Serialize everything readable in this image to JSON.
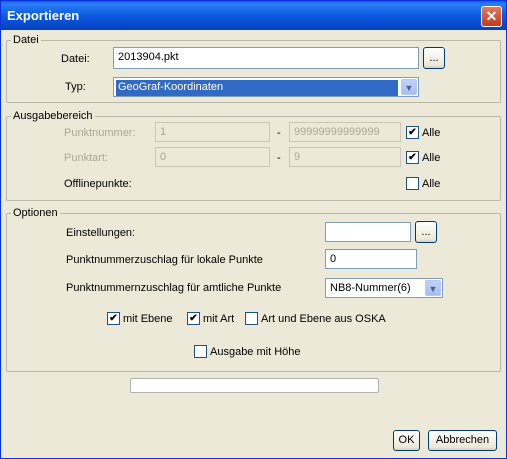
{
  "window": {
    "title": "Exportieren",
    "close_glyph": "✕"
  },
  "datei": {
    "legend": "Datei",
    "datei_label": "Datei:",
    "datei_value": "2013904.pkt",
    "browse_label": "...",
    "typ_label": "Typ:",
    "typ_value": "GeoGraf-Koordinaten"
  },
  "ausgabe": {
    "legend": "Ausgabebereich",
    "punktnummer_label": "Punktnummer:",
    "punktnummer_from": "1",
    "punktnummer_to": "99999999999999",
    "dash": "-",
    "punktart_label": "Punktart:",
    "punktart_from": "0",
    "punktart_to": "9",
    "offline_label": "Offlinepunkte:",
    "alle_label": "Alle",
    "punktnummer_alle": true,
    "punktart_alle": true,
    "offline_alle": false
  },
  "optionen": {
    "legend": "Optionen",
    "einstellungen_label": "Einstellungen:",
    "einstellungen_value": "",
    "browse_label": "...",
    "lokal_label": "Punktnummerzuschlag für lokale Punkte",
    "lokal_value": "0",
    "amtlich_label": "Punktnummernzuschlag für amtliche Punkte",
    "amtlich_value": "NB8-Nummer(6)",
    "mit_ebene_label": "mit Ebene",
    "mit_art_label": "mit Art",
    "oska_label": "Art und Ebene aus OSKA",
    "hoehe_label": "Ausgabe mit Höhe",
    "mit_ebene": true,
    "mit_art": true,
    "oska": false,
    "hoehe": false
  },
  "progress": {
    "value": 0
  },
  "buttons": {
    "ok": "OK",
    "abbrechen": "Abbrechen"
  },
  "icons": {
    "dropdown": "chevron-down-icon",
    "close": "close-icon"
  }
}
